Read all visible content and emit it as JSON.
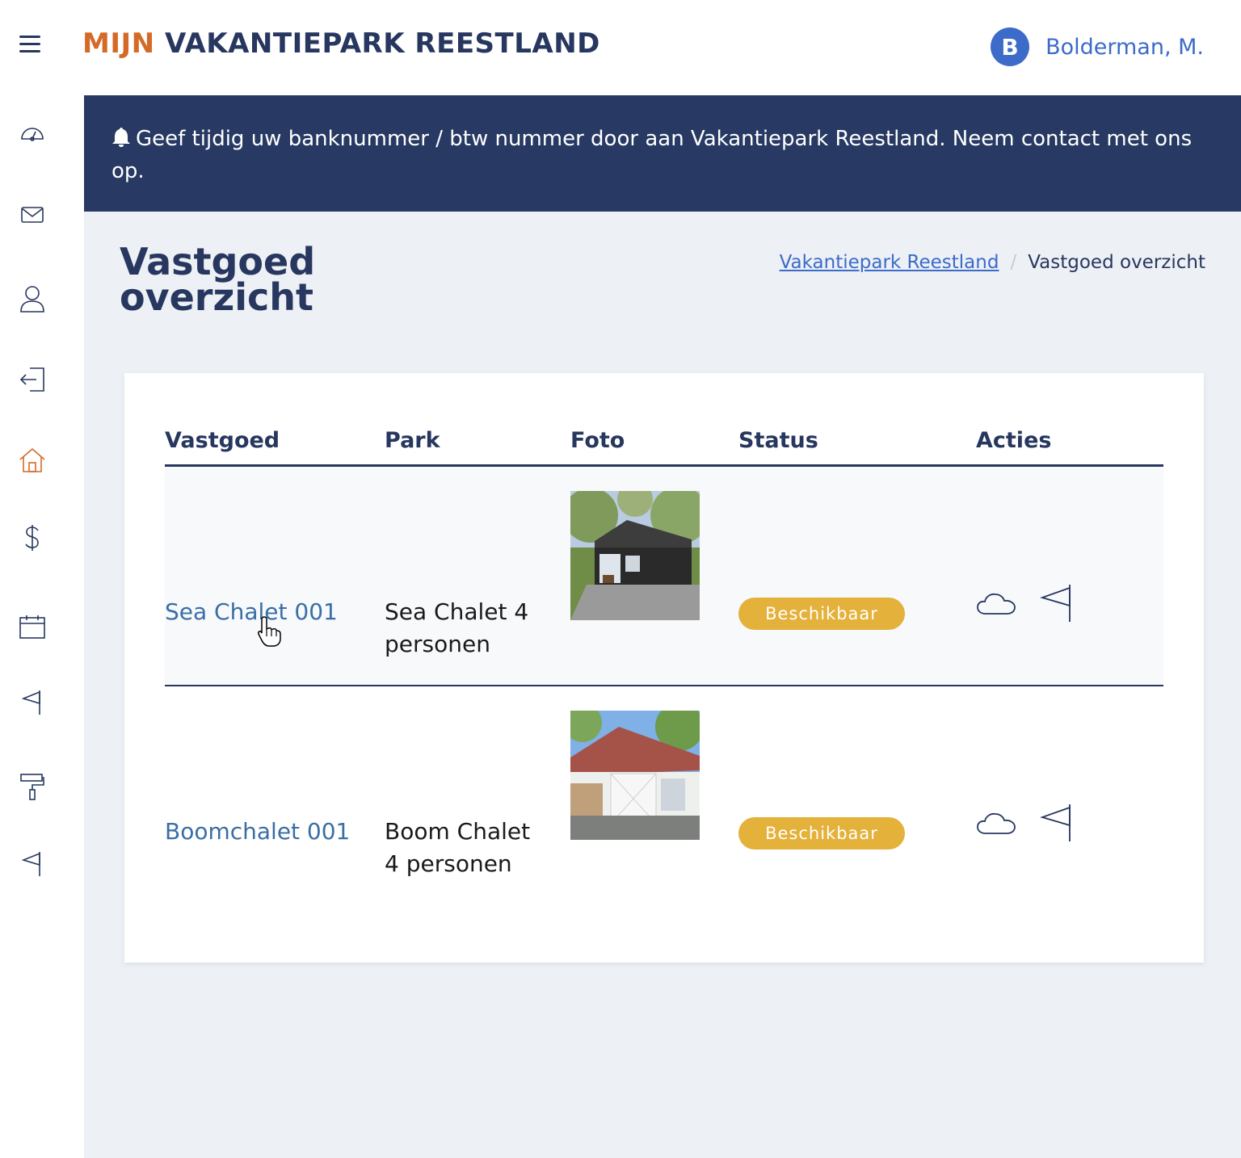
{
  "header": {
    "brand_accent": "MIJN",
    "brand_main": "VAKANTIEPARK REESTLAND",
    "user_initial": "B",
    "user_name": "Bolderman, M."
  },
  "sidebar": {
    "items": [
      {
        "icon": "gauge-icon"
      },
      {
        "icon": "mail-icon"
      },
      {
        "icon": "user-icon"
      },
      {
        "icon": "logout-icon"
      },
      {
        "icon": "home-icon",
        "active": true
      },
      {
        "icon": "dollar-icon"
      },
      {
        "icon": "calendar-icon"
      },
      {
        "icon": "flag-icon"
      },
      {
        "icon": "paint-roller-icon"
      },
      {
        "icon": "flag-icon"
      }
    ]
  },
  "alert": {
    "text": "Geef tijdig uw banknummer / btw nummer door aan Vakantiepark Reestland. Neem contact met ons op."
  },
  "page": {
    "title": "Vastgoed overzicht",
    "breadcrumb_link": "Vakantiepark Reestland",
    "breadcrumb_sep": "/",
    "breadcrumb_current": "Vastgoed overzicht"
  },
  "table": {
    "columns": [
      "Vastgoed",
      "Park",
      "Foto",
      "Status",
      "Acties"
    ],
    "rows": [
      {
        "vastgoed": "Sea Chalet 001",
        "park": "Sea Chalet 4 personen",
        "status": "Beschikbaar"
      },
      {
        "vastgoed": "Boomchalet 001",
        "park": "Boom Chalet 4 personen",
        "status": "Beschikbaar"
      }
    ]
  },
  "colors": {
    "navy": "#27375f",
    "accent_orange": "#d46a27",
    "link_blue": "#3c6bc9",
    "status_yellow": "#e4b13b"
  }
}
